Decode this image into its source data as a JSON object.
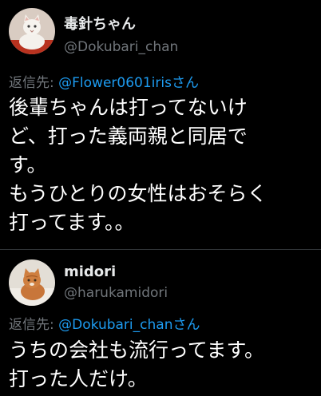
{
  "tweets": [
    {
      "display_name": "毒針ちゃん",
      "handle": "@Dokubari_chan",
      "reply_prefix": "返信先: ",
      "reply_to": "@Flower0601irisさん",
      "lines": [
        "後輩ちゃんは打ってないけ",
        "ど、打った義両親と同居で",
        "す。",
        "もうひとりの女性はおそらく",
        "打ってます。。"
      ],
      "avatar_icon": "cat-portrait-avatar"
    },
    {
      "display_name": "midori",
      "handle": "@harukamidori",
      "reply_prefix": "返信先: ",
      "reply_to": "@Dokubari_chanさん",
      "lines": [
        "うちの会社も流行ってます。",
        "打った人だけ。"
      ],
      "avatar_icon": "cat-photo-avatar"
    }
  ],
  "colors": {
    "background": "#000000",
    "text": "#ffffff",
    "muted": "#71767b",
    "link": "#1d9bf0",
    "divider": "#2f3336"
  }
}
